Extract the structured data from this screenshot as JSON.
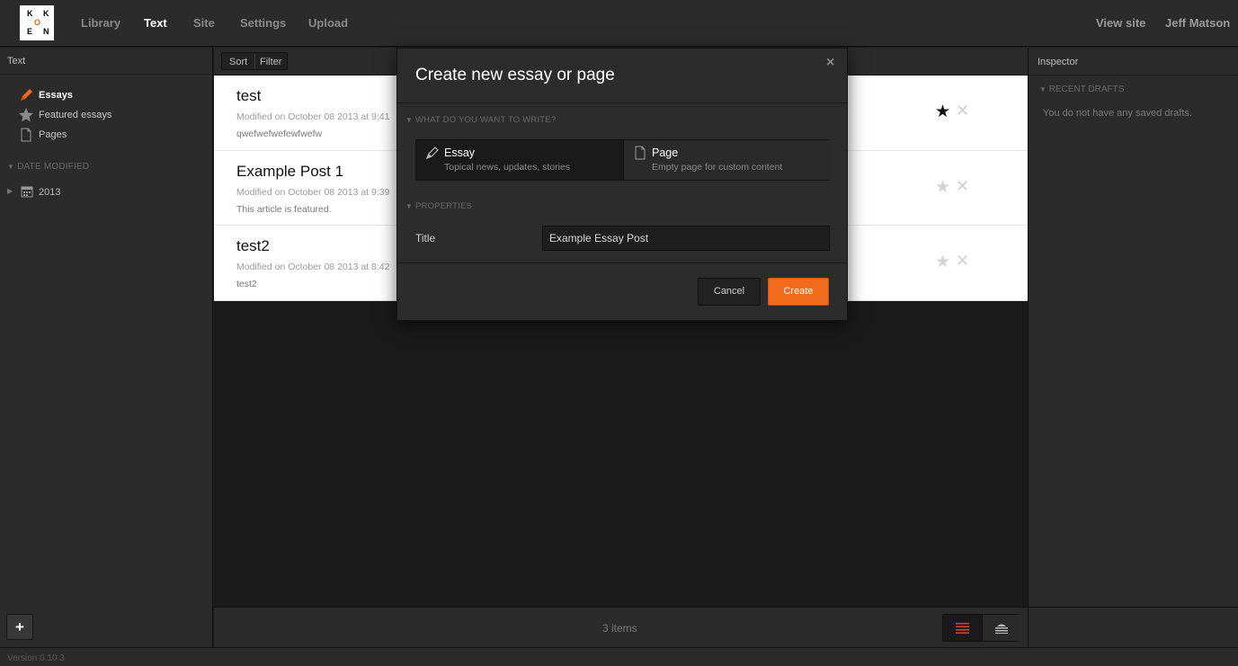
{
  "logo": {
    "letters": [
      "K",
      "O",
      "K",
      "E",
      "N"
    ],
    "accent": "#e8661c"
  },
  "topnav": {
    "items": [
      "Library",
      "Text",
      "Site",
      "Settings",
      "Upload"
    ],
    "active": "Text",
    "view_site": "View site",
    "user": "Jeff Matson"
  },
  "sidebar": {
    "title": "Text",
    "items": [
      {
        "label": "Essays",
        "icon": "pen-icon",
        "active": true
      },
      {
        "label": "Featured essays",
        "icon": "star-icon"
      },
      {
        "label": "Pages",
        "icon": "page-icon"
      }
    ],
    "section": "DATE MODIFIED",
    "year": "2013",
    "add_label": "+"
  },
  "toolbar": {
    "sort": "Sort",
    "filter": "Filter"
  },
  "list": {
    "rows": [
      {
        "title": "test",
        "modified": "Modified on October 08 2013 at 9:41",
        "excerpt": "qwefwefwefewfwefw",
        "featured": true
      },
      {
        "title": "Example Post 1",
        "modified": "Modified on October 08 2013 at 9:39",
        "excerpt": "This article is featured.",
        "featured": false
      },
      {
        "title": "test2",
        "modified": "Modified on October 08 2013 at 8:42",
        "excerpt": "test2",
        "featured": false
      }
    ],
    "count": "3 items"
  },
  "inspector": {
    "title": "Inspector",
    "section": "RECENT DRAFTS",
    "empty": "You do not have any saved drafts."
  },
  "footer": {
    "version": "Version 0.10.3"
  },
  "modal": {
    "title": "Create new essay or page",
    "close": "×",
    "section_write": "WHAT DO YOU WANT TO WRITE?",
    "types": [
      {
        "name": "Essay",
        "desc": "Topical news, updates, stories",
        "selected": true
      },
      {
        "name": "Page",
        "desc": "Empty page for custom content",
        "selected": false
      }
    ],
    "section_properties": "PROPERTIES",
    "title_label": "Title",
    "title_value": "Example Essay Post",
    "cancel": "Cancel",
    "create": "Create",
    "create_color": "#f26b1d"
  }
}
